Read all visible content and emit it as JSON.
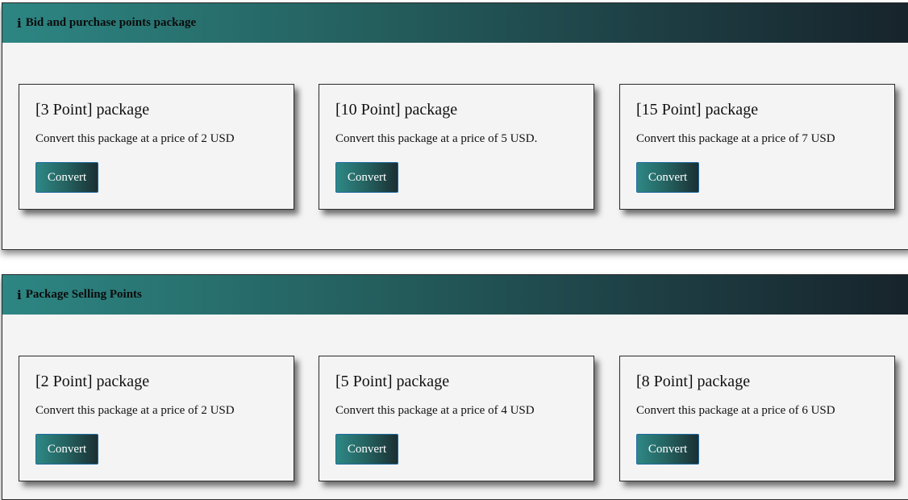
{
  "sections": [
    {
      "title": "Bid and purchase points package",
      "cards": [
        {
          "title": "[3 Point] package",
          "description": "Convert this package at a price of 2 USD",
          "button_label": "Convert"
        },
        {
          "title": "[10 Point] package",
          "description": "Convert this package at a price of 5 USD.",
          "button_label": "Convert"
        },
        {
          "title": "[15 Point] package",
          "description": "Convert this package at a price of 7 USD",
          "button_label": "Convert"
        }
      ]
    },
    {
      "title": "Package Selling Points",
      "cards": [
        {
          "title": "[2 Point] package",
          "description": "Convert this package at a price of 2 USD",
          "button_label": "Convert"
        },
        {
          "title": "[5 Point] package",
          "description": "Convert this package at a price of 4 USD",
          "button_label": "Convert"
        },
        {
          "title": "[8 Point] package",
          "description": "Convert this package at a price of 6 USD",
          "button_label": "Convert"
        }
      ]
    }
  ],
  "icons": {
    "section_header": "info-icon"
  },
  "colors": {
    "header_gradient_start": "#2d8683",
    "header_gradient_end": "#17232b",
    "button_border": "#1e6aa0",
    "panel_background": "#f4f4f4"
  }
}
